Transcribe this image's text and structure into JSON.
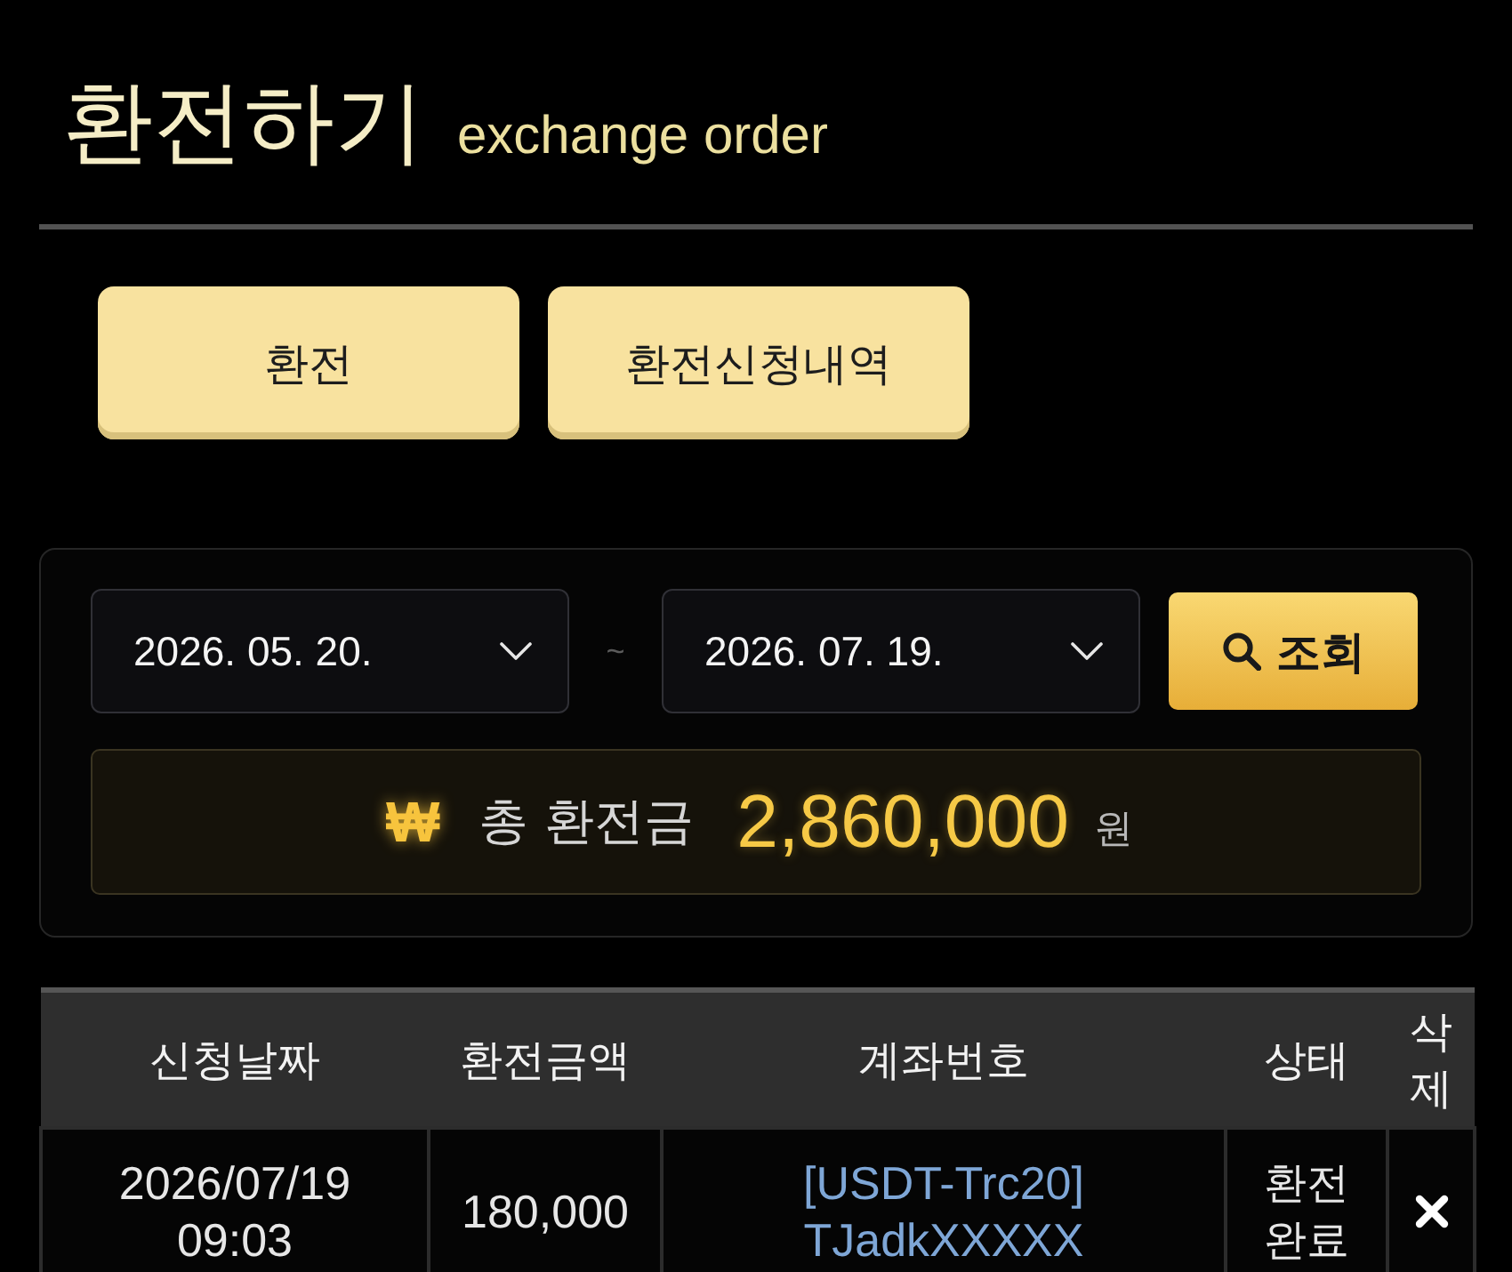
{
  "page": {
    "title": "환전하기",
    "subtitle": "exchange order"
  },
  "nav_buttons": [
    "환전",
    "환전신청내역"
  ],
  "filter": {
    "date_from": "2026. 05. 20.",
    "separator": "~",
    "date_to": "2026. 07. 19.",
    "search_button": "조회"
  },
  "total": {
    "currency_symbol": "₩",
    "label": "총 환전금",
    "amount": "2,860,000",
    "unit": "원"
  },
  "table": {
    "columns": [
      "신청날짜",
      "환전금액",
      "계좌번호",
      "상태",
      "삭제"
    ],
    "rows": [
      {
        "requested_at": "2026/07/19\n09:03",
        "amount": "180,000",
        "account": "[USDT-Trc20]\nTJadkXXXXX",
        "status": "환전완료"
      }
    ]
  }
}
